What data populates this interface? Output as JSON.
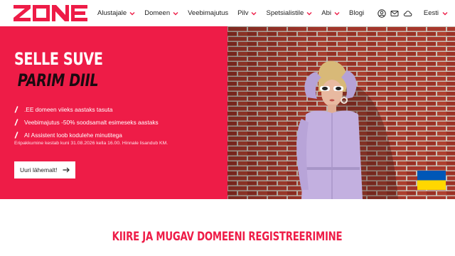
{
  "brand": {
    "name": "ZONE",
    "accent": "#ee1c47"
  },
  "nav": {
    "items": [
      {
        "label": "Alustajale",
        "has_dropdown": true
      },
      {
        "label": "Domeen",
        "has_dropdown": true
      },
      {
        "label": "Veebimajutus",
        "has_dropdown": false
      },
      {
        "label": "Pilv",
        "has_dropdown": true
      },
      {
        "label": "Spetsialistile",
        "has_dropdown": true
      },
      {
        "label": "Abi",
        "has_dropdown": true
      },
      {
        "label": "Blogi",
        "has_dropdown": false
      }
    ],
    "icons": [
      "user-icon",
      "mail-icon",
      "cloud-icon"
    ],
    "language": "Eesti"
  },
  "hero": {
    "title_line1": "SELLE SUVE",
    "title_line2": "PARIM DIIL",
    "bullets": [
      ".EE domeen viieks aastaks tasuta",
      "Veebimajutus -50% soodsamalt esimeseks aastaks",
      "AI Assistent loob kodulehe minutitega"
    ],
    "footnote": "Eripakkumine kestab kuni 31.08.2026 kella 16.00. Hinnale lisandub KM.",
    "cta_label": "Uuri lähemalt!",
    "flag_colors": [
      "#0057b7",
      "#ffd700"
    ]
  },
  "section": {
    "title": "KIIRE JA MUGAV DOMEENI REGISTREERIMINE"
  }
}
